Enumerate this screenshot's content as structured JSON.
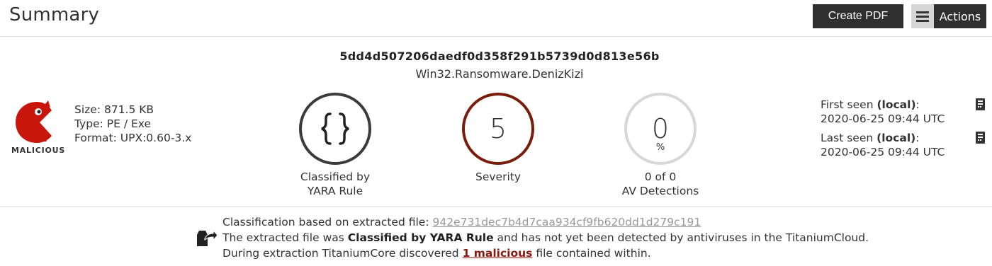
{
  "header": {
    "title": "Summary",
    "create_pdf_label": "Create PDF",
    "actions_label": "Actions"
  },
  "sample": {
    "hash": "5dd4d507206daedf0d358f291b5739d0d813e56b",
    "threat_name": "Win32.Ransomware.DenizKizi"
  },
  "badge": {
    "label": "MALICIOUS",
    "color": "#c8160c"
  },
  "file_info": {
    "size": "Size: 871.5 KB",
    "type": "Type: PE / Exe",
    "format": "Format: UPX:0.60-3.x"
  },
  "indicators": [
    {
      "value": "{}",
      "label_line1": "Classified by",
      "label_line2": "YARA Rule",
      "border_color": "#3b3b3b"
    },
    {
      "value": "5",
      "label_line1": "Severity",
      "label_line2": "",
      "border_color": "#7a1c0b"
    },
    {
      "value": "0",
      "unit": "%",
      "label_line1": "0 of 0",
      "label_line2": "AV Detections",
      "border_color": "#d7d7d7"
    }
  ],
  "seen": {
    "first_prefix": "First seen ",
    "first_tag": "(local)",
    "first_suffix": ":",
    "first_date": "2020-06-25 09:44 UTC",
    "last_prefix": "Last seen ",
    "last_tag": "(local)",
    "last_suffix": ":",
    "last_date": "2020-06-25 09:44 UTC"
  },
  "extraction": {
    "line1_prefix": "Classification based on extracted file: ",
    "line1_hash": "942e731dec7b4d7caa934cf9fb620dd1d279c191",
    "line2_prefix": "The extracted file was ",
    "line2_bold": "Classified by YARA Rule",
    "line2_suffix": " and has not yet been detected by antiviruses in the TitaniumCloud.",
    "line3_prefix": "During extraction TitaniumCore discovered ",
    "line3_link": "1 malicious",
    "line3_suffix": " file contained within."
  }
}
